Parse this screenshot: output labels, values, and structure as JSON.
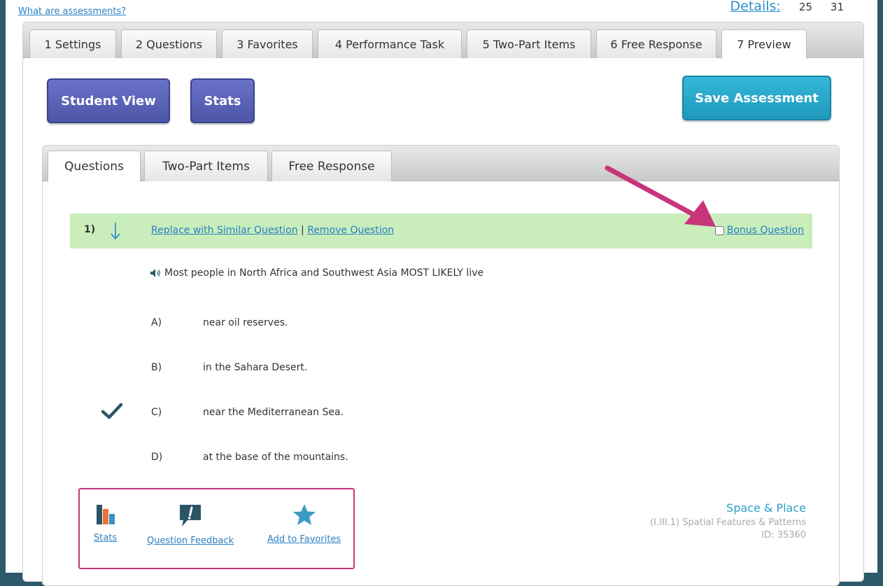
{
  "header": {
    "help_link": "What are assessments?",
    "details_label": "Details:",
    "details_value_1": "25",
    "details_value_2": "31"
  },
  "outer_tabs": [
    {
      "label": "1 Settings"
    },
    {
      "label": "2 Questions"
    },
    {
      "label": "3 Favorites"
    },
    {
      "label": "4 Performance Task"
    },
    {
      "label": "5 Two-Part Items"
    },
    {
      "label": "6 Free Response"
    },
    {
      "label": "7 Preview",
      "active": true
    }
  ],
  "buttons": {
    "student_view": "Student View",
    "stats": "Stats",
    "save": "Save Assessment"
  },
  "inner_tabs": [
    {
      "label": "Questions",
      "active": true
    },
    {
      "label": "Two-Part Items"
    },
    {
      "label": "Free Response"
    }
  ],
  "question": {
    "number": "1)",
    "replace_link": "Replace with Similar Question",
    "separator": "|",
    "remove_link": "Remove Question",
    "bonus_label": "Bonus Question",
    "bonus_checked": false,
    "text": "Most people in North Africa and Southwest Asia MOST LIKELY live",
    "choices": [
      {
        "letter": "A)",
        "text": "near oil reserves."
      },
      {
        "letter": "B)",
        "text": "in the Sahara Desert."
      },
      {
        "letter": "C)",
        "text": "near the Mediterranean Sea.",
        "correct": true
      },
      {
        "letter": "D)",
        "text": "at the base of the mountains."
      }
    ]
  },
  "tools": {
    "stats": "Stats",
    "feedback": "Question Feedback",
    "favorites": "Add to Favorites"
  },
  "meta": {
    "category": "Space & Place",
    "standard": "(I.III.1) Spatial Features & Patterns",
    "id": "ID: 35360"
  },
  "colors": {
    "purple_button": "#5a63b8",
    "teal_button": "#2aa8cc",
    "question_bar": "#c9eebc",
    "highlight": "#c8357a",
    "link": "#2a7fc1",
    "icon_dark": "#2b5566",
    "stats_orange": "#e8733a",
    "stats_blue": "#3d8fc0",
    "favorite_star": "#3a9cc4"
  },
  "icons": {
    "down_arrow": "arrow-down-icon",
    "speaker": "speaker-icon",
    "check": "check-icon",
    "stats": "bar-chart-icon",
    "feedback": "speech-bubble-exclamation-icon",
    "favorite": "star-icon",
    "annotation": "arrow-pointer-icon"
  }
}
